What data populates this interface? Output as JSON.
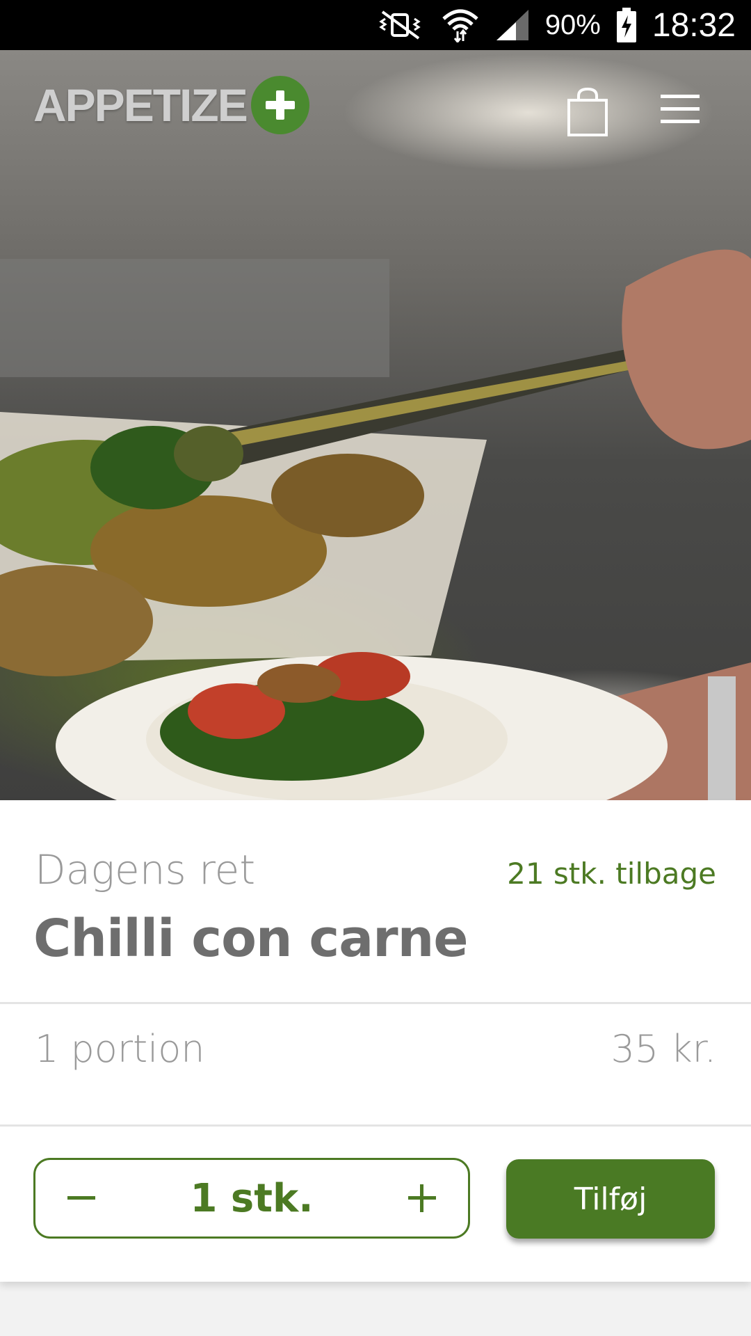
{
  "status_bar": {
    "battery": "90%",
    "time": "18:32",
    "icons": [
      "mute-vibrate-icon",
      "wifi-icon",
      "signal-icon",
      "battery-charging-icon"
    ]
  },
  "header": {
    "logo_text": "APPETIZE",
    "logo_symbol": "+",
    "icons": [
      "shopping-bag-icon",
      "hamburger-menu-icon"
    ]
  },
  "product": {
    "category": "Dagens ret",
    "stock": "21 stk. tilbage",
    "name": "Chilli con carne",
    "portion": "1 portion",
    "price": "35 kr."
  },
  "order": {
    "quantity": "1 stk.",
    "add_label": "Tilføj"
  },
  "colors": {
    "brand_green": "#4a7a24",
    "text_gray": "#6e6e6e",
    "light_gray": "#9a9a9a"
  }
}
